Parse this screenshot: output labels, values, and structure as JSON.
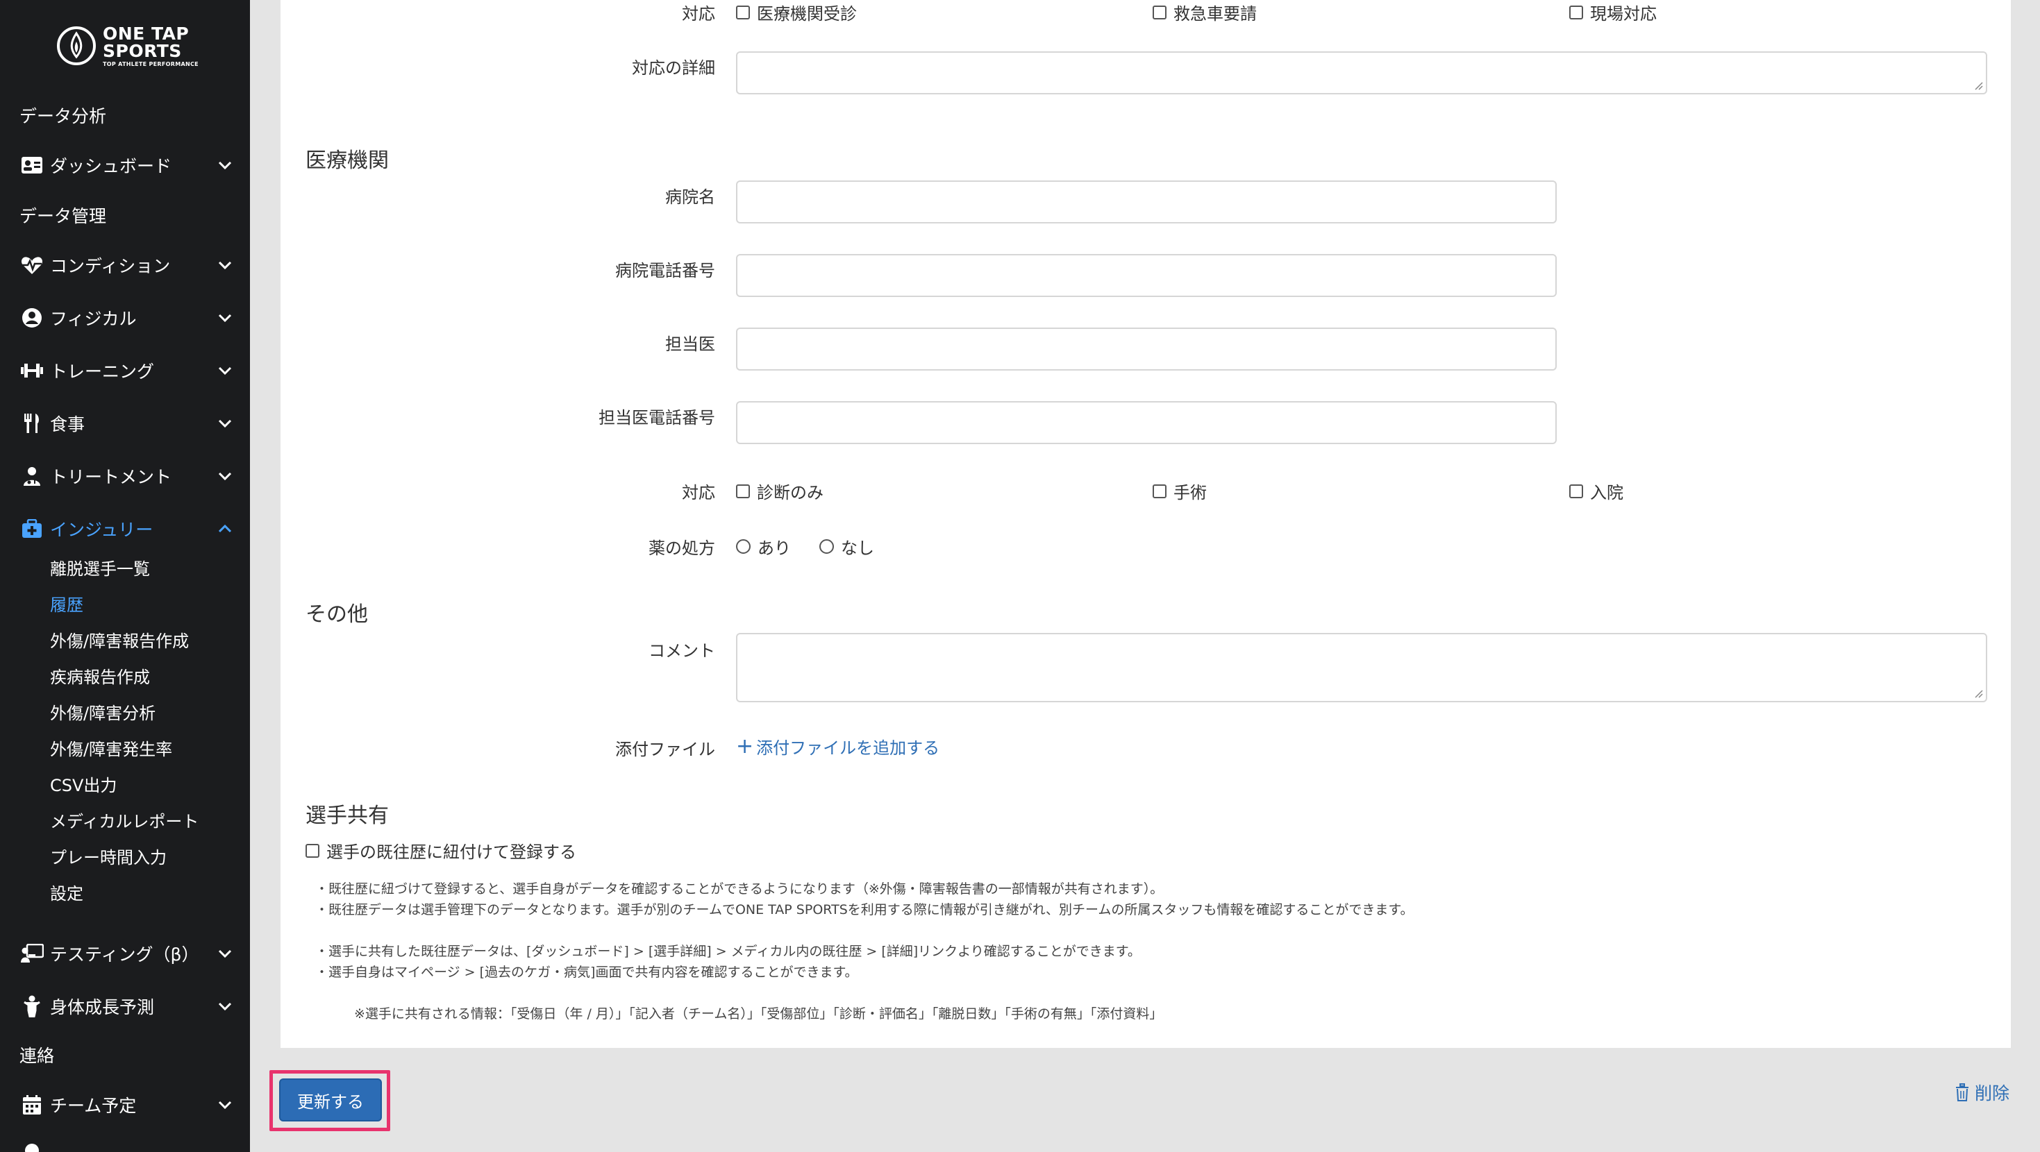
{
  "sidebar": {
    "logo": {
      "line1": "ONE TAP",
      "line2": "SPORTS",
      "tagline": "TOP ATHLETE PERFORMANCE"
    },
    "sections": {
      "analysis": "データ分析",
      "management": "データ管理",
      "contact": "連絡"
    },
    "items": [
      {
        "label": "ダッシュボード",
        "icon": "id-card-icon"
      },
      {
        "label": "コンディション",
        "icon": "heartbeat-icon"
      },
      {
        "label": "フィジカル",
        "icon": "user-circle-icon"
      },
      {
        "label": "トレーニング",
        "icon": "dumbbell-icon"
      },
      {
        "label": "食事",
        "icon": "utensils-icon"
      },
      {
        "label": "トリートメント",
        "icon": "user-doctor-icon"
      },
      {
        "label": "インジュリー",
        "icon": "medkit-icon"
      },
      {
        "label": "テスティング（β）",
        "icon": "chalkboard-teacher-icon"
      },
      {
        "label": "身体成長予測",
        "icon": "child-icon"
      },
      {
        "label": "チーム予定",
        "icon": "calendar-icon"
      }
    ],
    "injury_sub": [
      "離脱選手一覧",
      "履歴",
      "外傷/障害報告作成",
      "疾病報告作成",
      "外傷/障害分析",
      "外傷/障害発生率",
      "CSV出力",
      "メディカルレポート",
      "プレー時間入力",
      "設定"
    ]
  },
  "form": {
    "top_response": {
      "label": "対応",
      "options": [
        "医療機関受診",
        "救急車要請",
        "現場対応"
      ]
    },
    "response_detail_label": "対応の詳細",
    "medical": {
      "title": "医療機関",
      "hospital_label": "病院名",
      "hospital_phone_label": "病院電話番号",
      "doctor_label": "担当医",
      "doctor_phone_label": "担当医電話番号",
      "response_label": "対応",
      "response_options": [
        "診断のみ",
        "手術",
        "入院"
      ],
      "prescription_label": "薬の処方",
      "prescription_options": [
        "あり",
        "なし"
      ]
    },
    "other": {
      "title": "その他",
      "comment_label": "コメント",
      "attachment_label": "添付ファイル",
      "add_attachment": "添付ファイルを追加する"
    },
    "share": {
      "title": "選手共有",
      "checkbox_label": "選手の既往歴に紐付けて登録する",
      "notes": [
        "・既往歴に紐づけて登録すると、選手自身がデータを確認することができるようになります（※外傷・障害報告書の一部情報が共有されます）。",
        "・既往歴データは選手管理下のデータとなります。選手が別のチームでONE TAP SPORTSを利用する際に情報が引き継がれ、別チームの所属スタッフも情報を確認することができます。",
        "・選手に共有した既往歴データは、[ダッシュボード] > [選手詳細] > メディカル内の既往歴 > [詳細]リンクより確認することができます。",
        "・選手自身はマイページ > [過去のケガ・病気]画面で共有内容を確認することができます。",
        "※選手に共有される情報：「受傷日（年 / 月）」「記入者（チーム名）」「受傷部位」「診断・評価名」「離脱日数」「手術の有無」「添付資料」"
      ]
    }
  },
  "actions": {
    "update": "更新する",
    "delete": "削除"
  },
  "colors": {
    "sidebar_bg": "#1b1c1e",
    "accent": "#4aa3ff",
    "link": "#2f6fb5",
    "primary_button": "#2c6cb5",
    "highlight": "#e8336d"
  }
}
